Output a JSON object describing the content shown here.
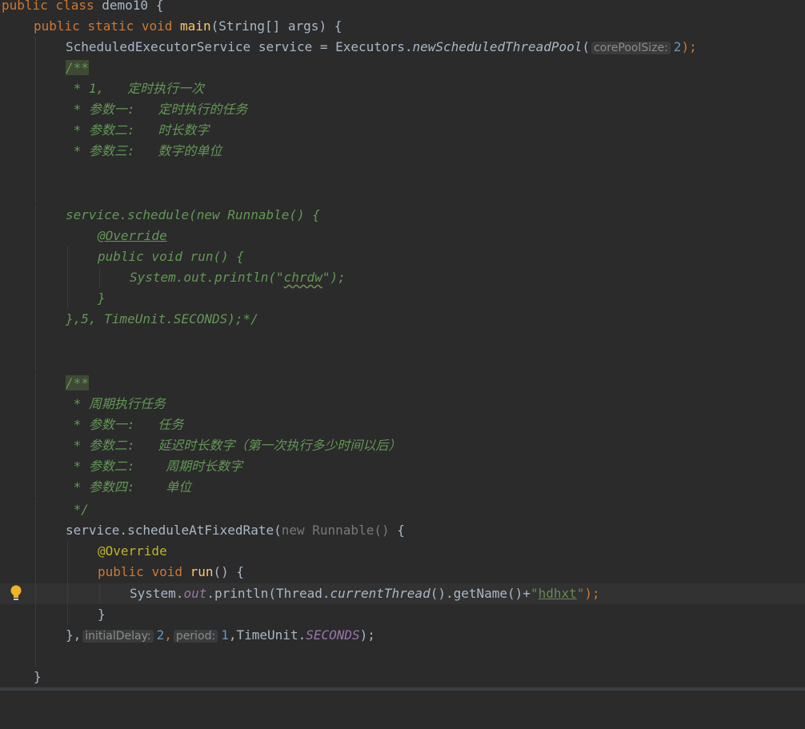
{
  "editor": {
    "line1": {
      "kw1": "public",
      "kw2": "class",
      "name": "demo10",
      "brace": "{"
    },
    "line2": {
      "kw1": "public",
      "kw2": "static",
      "kw3": "void",
      "method": "main",
      "args": "(String[] args) {"
    },
    "line3": {
      "pre": "ScheduledExecutorService service = Executors.",
      "method": "newScheduledThreadPool",
      "open": "(",
      "hint": "corePoolSize:",
      "num": "2",
      "close": ");"
    },
    "comment1": {
      "start": "/**",
      "l1": " * 1,   定时执行一次",
      "l2": " * 参数一:   定时执行的任务",
      "l3": " * 参数二:   时长数字",
      "l4": " * 参数三:   数字的单位",
      "l5": "service.schedule(new Runnable() {",
      "l6": "@Override",
      "l7": "public void run() {",
      "l8a": "System.out.println(\"",
      "l8b": "chrdw",
      "l8c": "\");",
      "l9": "}",
      "l10": "},5, TimeUnit.SECONDS);*/"
    },
    "comment2": {
      "start": "/**",
      "l1": " * 周期执行任务",
      "l2": " * 参数一:   任务",
      "l3": " * 参数二:   延迟时长数字（第一次执行多少时间以后）",
      "l4": " * 参数二:    周期时长数字",
      "l5": " * 参数四:    单位",
      "l6": " */"
    },
    "line_sched": {
      "pre": "service.scheduleAtFixedRate(",
      "kw": "new",
      "cls": "Runnable()",
      "post": " {"
    },
    "line_override": "@Override",
    "line_run": {
      "kw1": "public",
      "kw2": "void",
      "method": "run",
      "rest": "() {"
    },
    "line_print": {
      "a": "System.",
      "field": "out",
      "b": ".println(Thread.",
      "static_call": "currentThread",
      "c": "().getName()+",
      "str_open": "\"",
      "str": "hdhxt",
      "str_close": "\"",
      "d": ");"
    },
    "line_close_run": "}",
    "line_end": {
      "a": "},",
      "hint1": "initialDelay:",
      "n1": "2",
      "comma1": ",",
      "hint2": "period:",
      "n2": "1",
      "b": ",TimeUnit.",
      "field": "SECONDS",
      "c": ");"
    },
    "line_final": "}"
  },
  "colors": {
    "background": "#2b2b2b",
    "keyword": "#cc7832",
    "method": "#ffc66d",
    "string": "#6a8759",
    "number": "#6897bb",
    "annotation": "#bbb529",
    "doc_comment": "#629755",
    "static_field": "#9876aa"
  },
  "icons": {
    "gutter": "lightbulb-icon"
  }
}
